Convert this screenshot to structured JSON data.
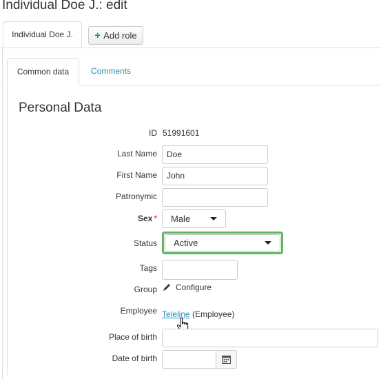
{
  "page": {
    "title": "Individual Doe J.: edit"
  },
  "outer_tabs": {
    "active_label": "Individual Doe J.",
    "add_role_label": "Add role"
  },
  "inner_tabs": {
    "common_data": "Common data",
    "comments": "Comments"
  },
  "section": {
    "title": "Personal Data"
  },
  "fields": {
    "id": {
      "label": "ID",
      "value": "51991601"
    },
    "last_name": {
      "label": "Last Name",
      "value": "Doe"
    },
    "first_name": {
      "label": "First Name",
      "value": "John"
    },
    "patronymic": {
      "label": "Patronymic",
      "value": ""
    },
    "sex": {
      "label": "Sex",
      "required_mark": "*",
      "value": "Male"
    },
    "status": {
      "label": "Status",
      "value": "Active"
    },
    "tags": {
      "label": "Tags",
      "value": ""
    },
    "group": {
      "label": "Group",
      "action_label": "Configure"
    },
    "employee": {
      "label": "Employee",
      "link_text": "Teleline",
      "suffix": "(Employee)"
    },
    "place_of_birth": {
      "label": "Place of birth",
      "value": ""
    },
    "date_of_birth": {
      "label": "Date of birth",
      "value": ""
    }
  },
  "colors": {
    "accent_link": "#2a8ab8",
    "status_highlight": "#5cb85c",
    "required": "#d9534f",
    "add_icon": "#2e9a3a"
  },
  "icons": {
    "add": "plus-icon",
    "edit": "pencil-icon",
    "calendar": "calendar-icon",
    "dropdown": "caret-down-icon",
    "cursor": "hand-pointer-icon"
  }
}
